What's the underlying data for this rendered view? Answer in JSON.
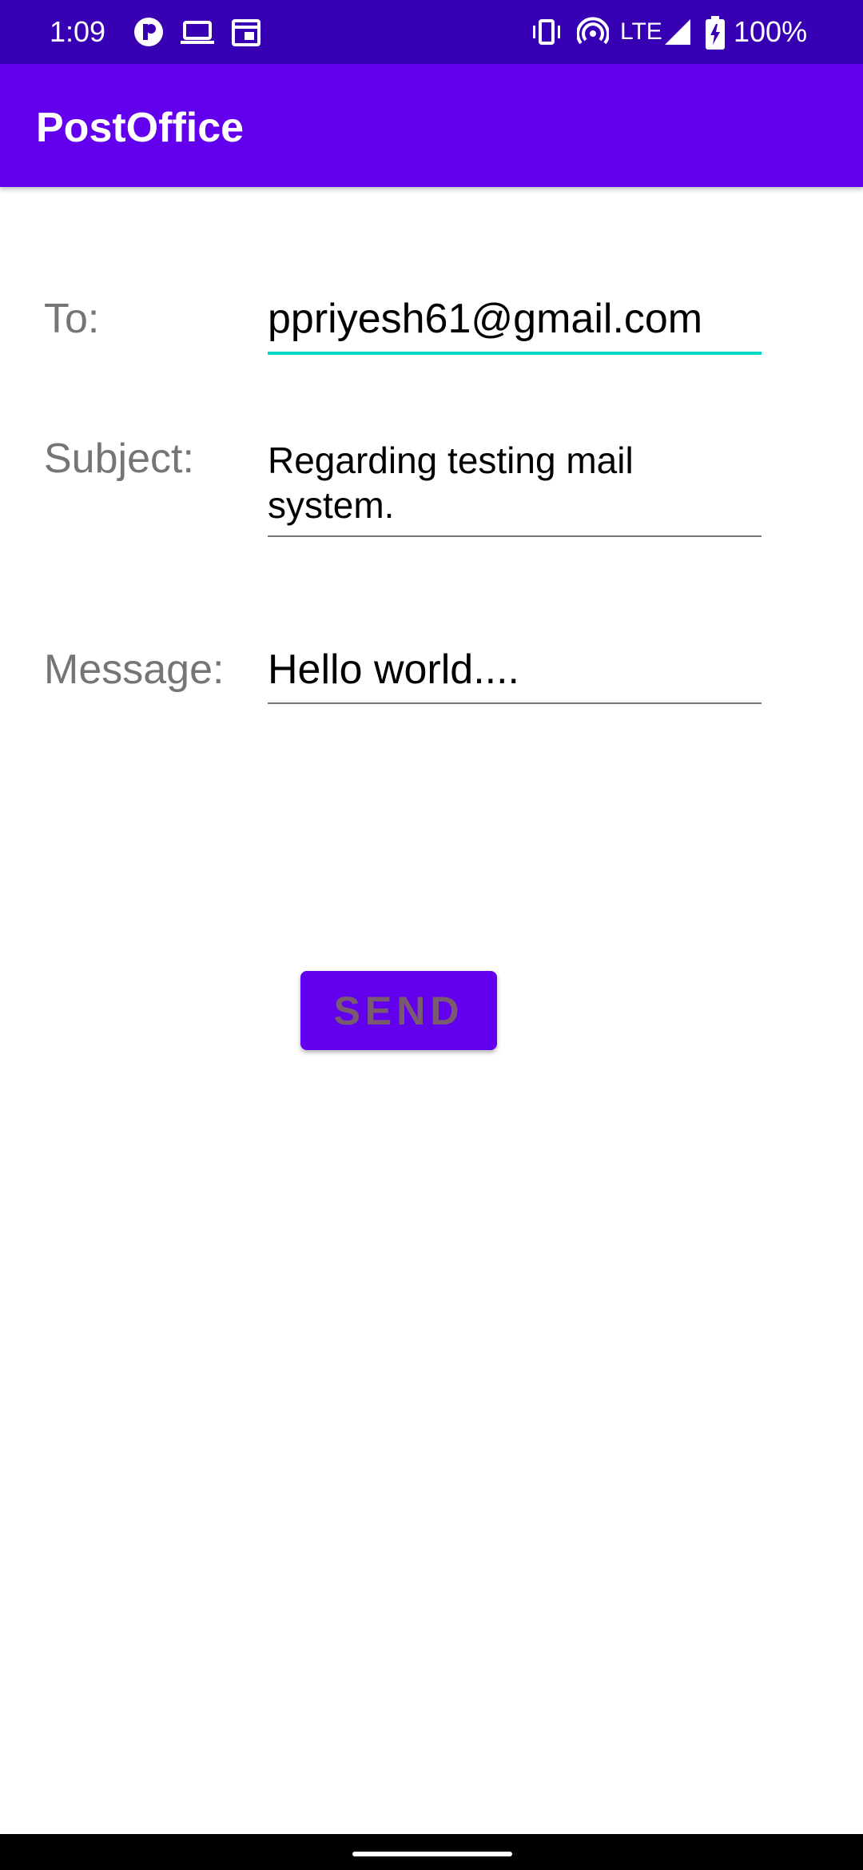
{
  "status_bar": {
    "time": "1:09",
    "network": "LTE",
    "battery": "100%",
    "icons": [
      "app-notification-icon",
      "laptop-icon",
      "calendar-icon",
      "vibrate-icon",
      "hotspot-icon",
      "signal-icon",
      "battery-charging-icon"
    ]
  },
  "app_bar": {
    "title": "PostOffice"
  },
  "form": {
    "to_label": "To:",
    "to_value": "ppriyesh61@gmail.com",
    "subject_label": "Subject:",
    "subject_value": "Regarding testing mail system.",
    "message_label": "Message:",
    "message_value": "Hello world....",
    "send_label": "SEND"
  },
  "colors": {
    "status_bar": "#3700b3",
    "primary": "#6200ee",
    "accent": "#03dac5"
  }
}
